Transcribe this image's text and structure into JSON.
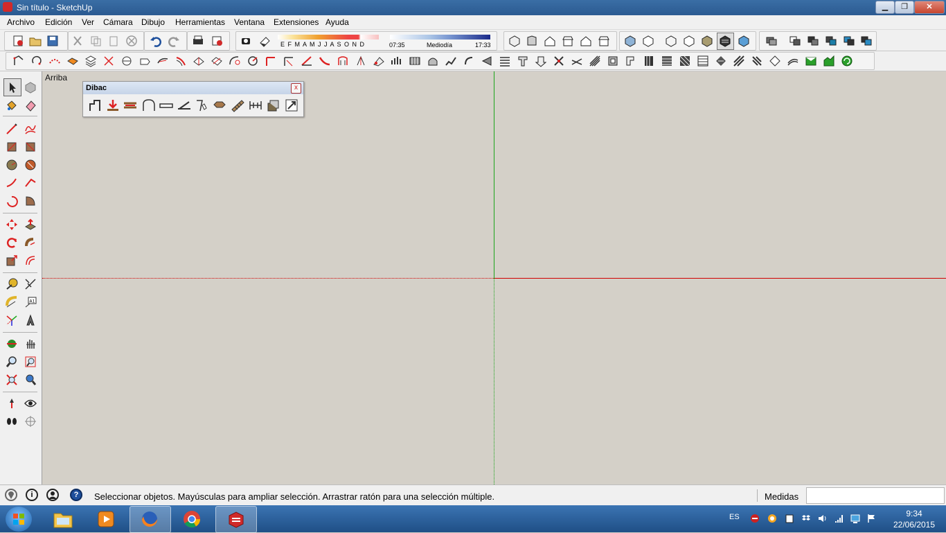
{
  "window": {
    "title": "Sin título - SketchUp",
    "minimize": "▁",
    "maximize": "❐",
    "close": "✕"
  },
  "menu": [
    "Archivo",
    "Edición",
    "Ver",
    "Cámara",
    "Dibujo",
    "Herramientas",
    "Ventana",
    "Extensiones",
    "Ayuda"
  ],
  "shadows": {
    "months": "E F M A M J J A S O N D",
    "time_start": "07:35",
    "time_mid": "Mediodía",
    "time_end": "17:33"
  },
  "view_label": "Arriba",
  "dibac": {
    "title": "Dibac",
    "close": "x"
  },
  "status": {
    "message": "Seleccionar objetos. Mayúsculas para ampliar selección. Arrastrar ratón para una selección múltiple.",
    "measures_label": "Medidas",
    "measures_value": "",
    "info_icon": "i",
    "help_icon": "?"
  },
  "taskbar": {
    "lang": "ES",
    "time": "9:34",
    "date": "22/06/2015",
    "apps": [
      "explorer-icon",
      "media-player-icon",
      "firefox-icon",
      "chrome-icon",
      "sketchup-icon"
    ]
  },
  "colors": {
    "axis_red": "#d00000",
    "axis_green": "#1aa51a",
    "canvas": "#d4d0c8",
    "taskbar": "#2a5f9e"
  }
}
